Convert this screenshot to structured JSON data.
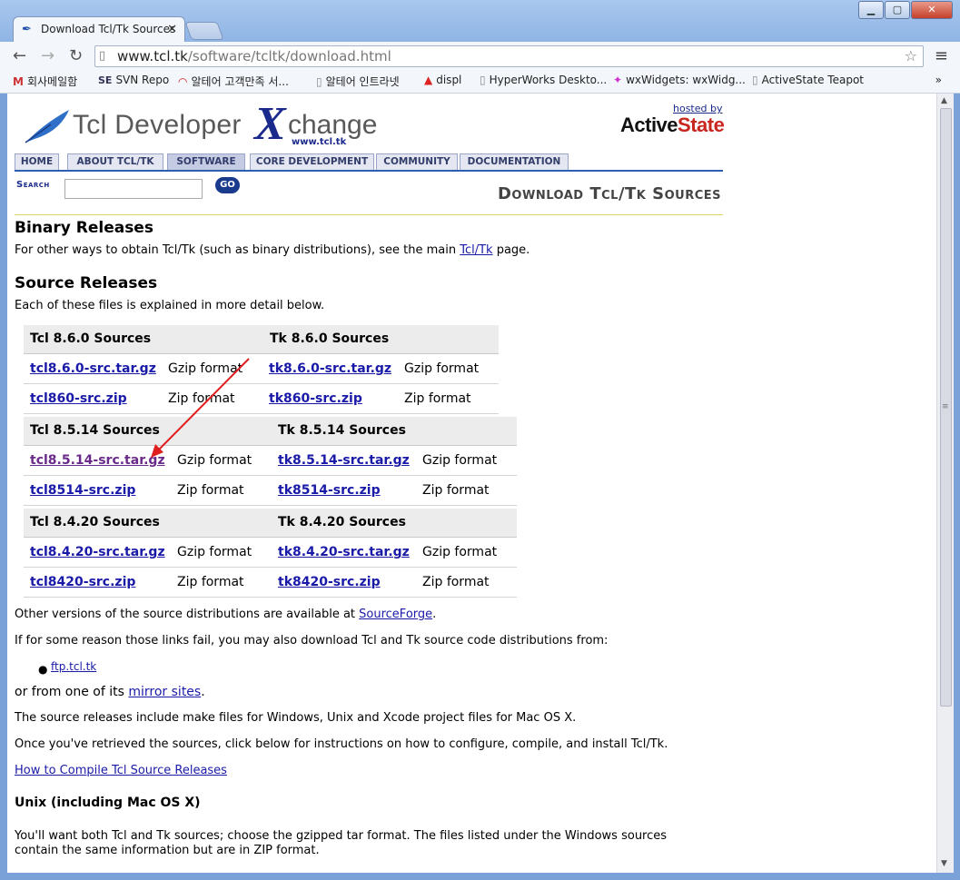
{
  "browser": {
    "tab_title": "Download Tcl/Tk Sources",
    "url_domain": "www.tcl.tk",
    "url_path": "/software/tcltk/download.html",
    "bookmarks": [
      {
        "label": "회사메일함",
        "icon": "gmail-icon"
      },
      {
        "label": "SVN Repo",
        "icon": "svn-icon"
      },
      {
        "label": "알테어 고객만족 서...",
        "icon": "altair-icon"
      },
      {
        "label": "알테어 인트라넷",
        "icon": "page-icon"
      },
      {
        "label": "displ",
        "icon": "alert-icon"
      },
      {
        "label": "HyperWorks Deskto...",
        "icon": "page-icon"
      },
      {
        "label": "wxWidgets: wxWidg...",
        "icon": "wx-icon"
      },
      {
        "label": "ActiveState Teapot",
        "icon": "page-icon"
      }
    ],
    "bookmarks_more": "»"
  },
  "header": {
    "logo_tcl": "Tcl Developer",
    "logo_x": "X",
    "logo_change": "change",
    "logo_sub": "www.tcl.tk",
    "hosted_by": "hosted by",
    "sponsor_a": "Active",
    "sponsor_b": "State",
    "nav": [
      "HOME",
      "ABOUT TCL/TK",
      "SOFTWARE",
      "CORE DEVELOPMENT",
      "COMMUNITY",
      "DOCUMENTATION"
    ],
    "search_label": "Search",
    "go_label": "GO",
    "page_heading": "Download Tcl/Tk Sources"
  },
  "content": {
    "binary_title": "Binary Releases",
    "binary_text_pre": "For other ways to obtain Tcl/Tk (such as binary distributions), see the main ",
    "binary_link": "Tcl/Tk",
    "binary_text_post": " page.",
    "source_title": "Source Releases",
    "source_text": "Each of these files is explained in more detail below.",
    "groups": [
      {
        "tcl_header": "Tcl 8.6.0 Sources",
        "tk_header": "Tk 8.6.0 Sources",
        "rows": [
          {
            "tcl": "tcl8.6.0-src.tar.gz",
            "tcl_fmt": "Gzip format",
            "tk": "tk8.6.0-src.tar.gz",
            "tk_fmt": "Gzip format"
          },
          {
            "tcl": "tcl860-src.zip",
            "tcl_fmt": "Zip format",
            "tk": "tk860-src.zip",
            "tk_fmt": "Zip format"
          }
        ]
      },
      {
        "tcl_header": "Tcl 8.5.14 Sources",
        "tk_header": "Tk 8.5.14 Sources",
        "rows": [
          {
            "tcl": "tcl8.5.14-src.tar.gz",
            "tcl_fmt": "Gzip format",
            "tk": "tk8.5.14-src.tar.gz",
            "tk_fmt": "Gzip format"
          },
          {
            "tcl": "tcl8514-src.zip",
            "tcl_fmt": "Zip format",
            "tk": "tk8514-src.zip",
            "tk_fmt": "Zip format"
          }
        ]
      },
      {
        "tcl_header": "Tcl 8.4.20 Sources",
        "tk_header": "Tk 8.4.20 Sources",
        "rows": [
          {
            "tcl": "tcl8.4.20-src.tar.gz",
            "tcl_fmt": "Gzip format",
            "tk": "tk8.4.20-src.tar.gz",
            "tk_fmt": "Gzip format"
          },
          {
            "tcl": "tcl8420-src.zip",
            "tcl_fmt": "Zip format",
            "tk": "tk8420-src.zip",
            "tk_fmt": "Zip format"
          }
        ]
      }
    ],
    "other_versions_pre": "Other versions of the source distributions are available at ",
    "other_versions_link": "SourceForge",
    "other_versions_post": ".",
    "fail_text": "If for some reason those links fail, you may also download Tcl and Tk source code distributions from:",
    "ftp_link": "ftp.tcl.tk",
    "mirror_pre": "or from one of its ",
    "mirror_link": "mirror sites",
    "mirror_post": ".",
    "make_files_text": "The source releases include make files for Windows, Unix and Xcode project files for Mac OS X.",
    "retrieved_text": "Once you've retrieved the sources, click below for instructions on how to configure, compile, and install Tcl/Tk.",
    "compile_link": "How to Compile Tcl Source Releases",
    "unix_title": "Unix (including Mac OS X)",
    "unix_text_1": "You'll want both Tcl and Tk sources; choose the gzipped tar format. The files listed under the Windows sources",
    "unix_text_2": "contain the same information but are in ZIP format."
  },
  "colors": {
    "link": "#1a1aa8",
    "visited": "#6a2a8a",
    "nav_rule": "#2c5fb2",
    "annotation_arrow": "#e02020"
  }
}
